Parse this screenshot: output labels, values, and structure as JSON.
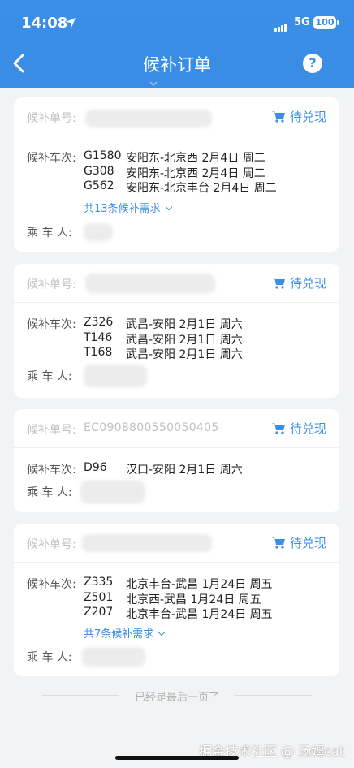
{
  "status_bar": {
    "time": "14:08",
    "network": "5G",
    "battery": "100"
  },
  "nav": {
    "title": "候补订单",
    "help": "?"
  },
  "labels": {
    "order_no": "候补单号:",
    "trains": "候补车次:",
    "passenger": "乘 车 人:"
  },
  "orders": [
    {
      "order_no": "",
      "status": "待兑现",
      "trains": [
        {
          "code": "G1580",
          "route": "安阳东-北京西 2月4日 周二"
        },
        {
          "code": "G308",
          "route": "安阳东-北京西 2月4日 周二"
        },
        {
          "code": "G562",
          "route": "安阳东-北京丰台 2月4日 周二"
        }
      ],
      "more": "共13条候补需求"
    },
    {
      "order_no": "",
      "status": "待兑现",
      "trains": [
        {
          "code": "Z326",
          "route": "武昌-安阳 2月1日 周六"
        },
        {
          "code": "T146",
          "route": "武昌-安阳 2月1日 周六"
        },
        {
          "code": "T168",
          "route": "武昌-安阳 2月1日 周六"
        }
      ],
      "more": ""
    },
    {
      "order_no": "EC0908800550050405",
      "status": "待兑现",
      "trains": [
        {
          "code": "D96",
          "route": "汉口-安阳 2月1日 周六"
        }
      ],
      "more": ""
    },
    {
      "order_no": "",
      "status": "待兑现",
      "trains": [
        {
          "code": "Z335",
          "route": "北京丰台-武昌 1月24日 周五"
        },
        {
          "code": "Z501",
          "route": "北京西-武昌 1月24日 周五"
        },
        {
          "code": "Z207",
          "route": "北京丰台-武昌 1月24日 周五"
        }
      ],
      "more": "共7条候补需求"
    }
  ],
  "footer": "已经是最后一页了",
  "watermark": "掘金技术社区 @ 汤姆cat",
  "colors": {
    "primary": "#3a8ee6",
    "background": "#f2f3f5"
  }
}
